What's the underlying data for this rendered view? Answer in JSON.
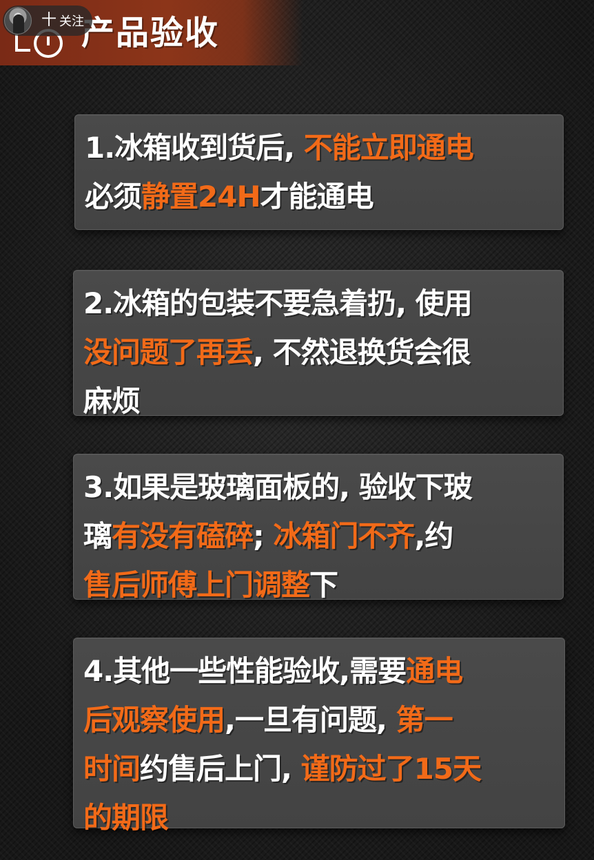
{
  "header": {
    "title": "产品验收",
    "follow_label": "关注",
    "plus_glyph": "十"
  },
  "colors": {
    "highlight": "#f26a18",
    "banner": "#8c3519",
    "card": "#474747",
    "text": "#ffffff"
  },
  "icons": [
    "avatar",
    "plus-icon",
    "clock-icon"
  ],
  "cards": [
    {
      "lines": [
        [
          {
            "t": "1.冰箱收到货后, "
          },
          {
            "t": "不能立即通电",
            "hl": true
          }
        ],
        [
          {
            "t": "必须"
          },
          {
            "t": "静置24H",
            "hl": true
          },
          {
            "t": "才能通电"
          }
        ]
      ]
    },
    {
      "lines": [
        [
          {
            "t": "2.冰箱的包装不要急着扔, 使用"
          }
        ],
        [
          {
            "t": "没问题了再丢",
            "hl": true
          },
          {
            "t": ", 不然退换货会很"
          }
        ],
        [
          {
            "t": "麻烦"
          }
        ]
      ]
    },
    {
      "lines": [
        [
          {
            "t": "3.如果是玻璃面板的, 验收下玻"
          }
        ],
        [
          {
            "t": "璃"
          },
          {
            "t": "有没有磕碎",
            "hl": true
          },
          {
            "t": "; "
          },
          {
            "t": "冰箱门不齐",
            "hl": true
          },
          {
            "t": ",约"
          }
        ],
        [
          {
            "t": "售后师傅上门调整",
            "hl": true
          },
          {
            "t": "下"
          }
        ]
      ]
    },
    {
      "lines": [
        [
          {
            "t": "4.其他一些性能验收,需要"
          },
          {
            "t": "通电",
            "hl": true
          }
        ],
        [
          {
            "t": "后观察使用",
            "hl": true
          },
          {
            "t": ",一旦有问题, "
          },
          {
            "t": "第一",
            "hl": true
          }
        ],
        [
          {
            "t": "时间",
            "hl": true
          },
          {
            "t": "约售后上门, "
          },
          {
            "t": "谨防过了15天",
            "hl": true
          }
        ],
        [
          {
            "t": "的期限",
            "hl": true
          }
        ]
      ]
    }
  ]
}
